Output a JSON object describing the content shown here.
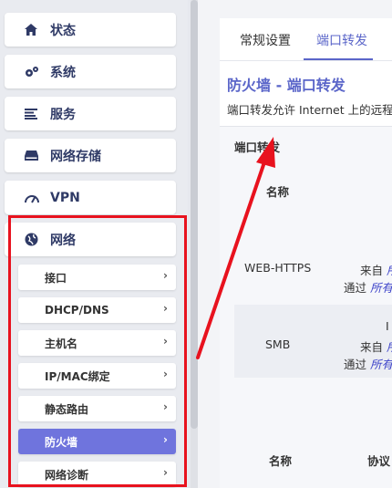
{
  "sidebar": {
    "items": [
      {
        "label": "状态",
        "icon": "home-icon"
      },
      {
        "label": "系统",
        "icon": "gears-icon"
      },
      {
        "label": "服务",
        "icon": "list-icon"
      },
      {
        "label": "网络存储",
        "icon": "drive-icon"
      },
      {
        "label": "VPN",
        "icon": "gauge-icon"
      },
      {
        "label": "网络",
        "icon": "globe-icon"
      }
    ],
    "subitems": [
      {
        "label": "接口"
      },
      {
        "label": "DHCP/DNS"
      },
      {
        "label": "主机名"
      },
      {
        "label": "IP/MAC绑定"
      },
      {
        "label": "静态路由"
      },
      {
        "label": "防火墙",
        "active": true
      },
      {
        "label": "网络诊断"
      }
    ],
    "chevron": "›"
  },
  "tabs": [
    {
      "label": "常规设置"
    },
    {
      "label": "端口转发",
      "active": true
    }
  ],
  "page": {
    "title": "防火墙 - 端口转发",
    "description": "端口转发允许 Internet 上的远程"
  },
  "section": {
    "title": "端口转发",
    "col_name": "名称",
    "rows": [
      {
        "name": "WEB-HTTPS",
        "from_label": "来自",
        "from_value": "所",
        "via_label": "通过",
        "via_value": "所有"
      },
      {
        "name": "SMB",
        "proto_fragment": "I",
        "from_label": "来自",
        "from_value": "所",
        "via_label": "通过",
        "via_value": "所有"
      }
    ],
    "bottom_col_name": "名称",
    "bottom_col_protocol": "协议"
  },
  "colors": {
    "accent": "#5b66c9",
    "active_item": "#6f74dd",
    "annotation_red": "#e8121e",
    "link": "#3d43c9"
  }
}
